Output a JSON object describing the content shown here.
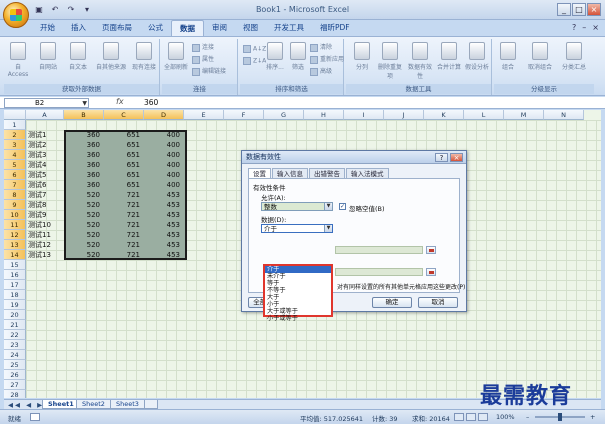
{
  "app": {
    "title": "Book1 - Microsoft Excel",
    "qat": [
      "▣",
      "↶",
      "↷",
      "▾"
    ],
    "window_controls": [
      "_",
      "□",
      "×"
    ]
  },
  "tabs": [
    "开始",
    "插入",
    "页面布局",
    "公式",
    "数据",
    "审阅",
    "视图",
    "开发工具",
    "福昕PDF"
  ],
  "active_tab": "数据",
  "tab_right_icons": [
    "?",
    "–",
    "×"
  ],
  "ribbon": {
    "groups": [
      {
        "name": "获取外部数据",
        "buttons": [
          "自 Access",
          "自网站",
          "自文本",
          "自其他来源",
          "现有连接"
        ]
      },
      {
        "name": "连接",
        "buttons": [
          "全部刷新"
        ],
        "small": [
          "连接",
          "属性",
          "编辑链接"
        ]
      },
      {
        "name": "排序和筛选",
        "buttons": [
          "排序...",
          "筛选"
        ],
        "small": [
          "清除",
          "重新应用",
          "高级"
        ]
      },
      {
        "name": "数据工具",
        "buttons": [
          "分列",
          "删除重复项",
          "数据有效性",
          "合并计算",
          "假设分析"
        ]
      },
      {
        "name": "分级显示",
        "buttons": [
          "组合",
          "取消组合",
          "分类汇总"
        ]
      }
    ]
  },
  "formula_bar": {
    "cell": "B2",
    "fx": "fx",
    "value": "360"
  },
  "columns": [
    "A",
    "B",
    "C",
    "D",
    "E",
    "F",
    "G",
    "H",
    "I",
    "J",
    "K",
    "L",
    "M",
    "N"
  ],
  "rows": [
    "1",
    "2",
    "3",
    "4",
    "5",
    "6",
    "7",
    "8",
    "9",
    "10",
    "11",
    "12",
    "13",
    "14",
    "15",
    "16",
    "17",
    "18",
    "19",
    "20",
    "21",
    "22",
    "23",
    "24",
    "25",
    "26",
    "27",
    "28"
  ],
  "cells": {
    "names": [
      "测试1",
      "测试2",
      "测试3",
      "测试4",
      "测试5",
      "测试6",
      "测试7",
      "测试8",
      "测试9",
      "测试10",
      "测试11",
      "测试12",
      "测试13"
    ],
    "b": [
      "360",
      "360",
      "360",
      "360",
      "360",
      "360",
      "520",
      "520",
      "520",
      "520",
      "520",
      "520",
      "520"
    ],
    "c": [
      "651",
      "651",
      "651",
      "651",
      "651",
      "651",
      "721",
      "721",
      "721",
      "721",
      "721",
      "721",
      "721"
    ],
    "d": [
      "400",
      "400",
      "400",
      "400",
      "400",
      "400",
      "453",
      "453",
      "453",
      "453",
      "453",
      "453",
      "453"
    ]
  },
  "sheet_tabs": [
    "Sheet1",
    "Sheet2",
    "Sheet3"
  ],
  "sheet_nav": "◀◀ ◀ ▶ ▶▶",
  "status": {
    "mode": "就绪",
    "average": "平均值: 517.025641",
    "count": "计数: 39",
    "sum": "求和: 20164",
    "zoom": "100%"
  },
  "dialog": {
    "title": "数据有效性",
    "tabs": [
      "设置",
      "输入信息",
      "出错警告",
      "输入法模式"
    ],
    "criteria_label": "有效性条件",
    "allow_label": "允许(A):",
    "allow_value": "整数",
    "ignore_blank": "忽略空值(B)",
    "data_label": "数据(D):",
    "data_value": "介于",
    "options": [
      "介于",
      "未介于",
      "等于",
      "不等于",
      "大于",
      "小于",
      "大于或等于",
      "小于或等于"
    ],
    "apply_text": "对有同样设置的所有其他单元格应用这些更改(P)",
    "clear_all": "全部清除(C)",
    "ok": "确定",
    "cancel": "取消"
  },
  "watermark": "最需教育"
}
